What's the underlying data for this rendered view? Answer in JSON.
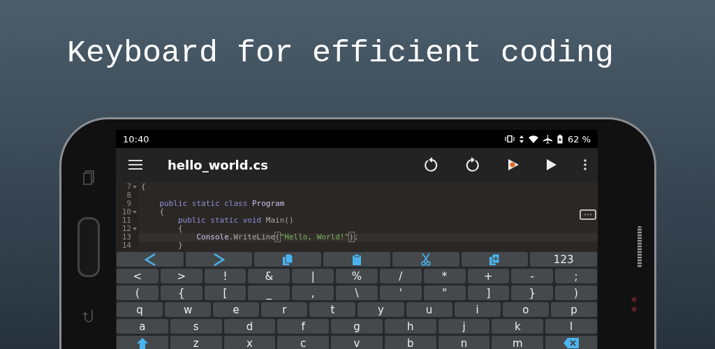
{
  "headline": "Keyboard for efficient coding",
  "status_bar": {
    "time": "10:40",
    "battery": "62 %"
  },
  "toolbar": {
    "title": "hello_world.cs"
  },
  "editor": {
    "lines": [
      {
        "number": "7",
        "fold": true,
        "current": false,
        "tokens": [
          {
            "text": "{",
            "kind": "plain"
          }
        ]
      },
      {
        "number": "8",
        "fold": false,
        "current": false
      },
      {
        "number": "9",
        "fold": false,
        "current": false,
        "tokens": [
          {
            "text": "    public static class ",
            "kind": "keyword"
          },
          {
            "text": "Program",
            "kind": "type"
          }
        ]
      },
      {
        "number": "10",
        "fold": true,
        "current": false,
        "tokens": [
          {
            "text": "    {",
            "kind": "plain"
          }
        ]
      },
      {
        "number": "11",
        "fold": false,
        "current": false,
        "tokens": [
          {
            "text": "        public static void ",
            "kind": "keyword"
          },
          {
            "text": "Main()",
            "kind": "plain"
          }
        ]
      },
      {
        "number": "12",
        "fold": true,
        "current": false,
        "tokens": [
          {
            "text": "        {",
            "kind": "plain"
          }
        ]
      },
      {
        "number": "13",
        "fold": false,
        "current": true,
        "tokens": [
          {
            "text": "            Console",
            "kind": "type"
          },
          {
            "text": ".WriteLine",
            "kind": "plain"
          },
          {
            "text": "(",
            "kind": "match"
          },
          {
            "text": "\"Hello, World!\"",
            "kind": "string"
          },
          {
            "text": ")",
            "kind": "match"
          },
          {
            "text": ";",
            "kind": "plain"
          }
        ]
      },
      {
        "number": "14",
        "fold": false,
        "current": false,
        "tokens": [
          {
            "text": "        }",
            "kind": "plain"
          }
        ]
      }
    ]
  },
  "keyboard": {
    "rows": [
      {
        "keys": [
          {
            "kind": "left"
          },
          {
            "kind": "right"
          },
          {
            "kind": "copy"
          },
          {
            "kind": "paste"
          },
          {
            "kind": "cut"
          },
          {
            "kind": "duplicate"
          },
          {
            "kind": "text",
            "label": "123"
          }
        ]
      },
      {
        "keys": [
          {
            "kind": "text",
            "label": "<"
          },
          {
            "kind": "text",
            "label": ">"
          },
          {
            "kind": "text",
            "label": "!"
          },
          {
            "kind": "text",
            "label": "&"
          },
          {
            "kind": "text",
            "label": "|"
          },
          {
            "kind": "text",
            "label": "%"
          },
          {
            "kind": "text",
            "label": "/"
          },
          {
            "kind": "text",
            "label": "*"
          },
          {
            "kind": "text",
            "label": "+"
          },
          {
            "kind": "text",
            "label": "-"
          },
          {
            "kind": "text",
            "label": ";"
          }
        ]
      },
      {
        "keys": [
          {
            "kind": "text",
            "label": "("
          },
          {
            "kind": "text",
            "label": "{"
          },
          {
            "kind": "text",
            "label": "["
          },
          {
            "kind": "text",
            "label": "_"
          },
          {
            "kind": "text",
            "label": ","
          },
          {
            "kind": "text",
            "label": "\\"
          },
          {
            "kind": "text",
            "label": "'"
          },
          {
            "kind": "text",
            "label": "\""
          },
          {
            "kind": "text",
            "label": "]"
          },
          {
            "kind": "text",
            "label": "}"
          },
          {
            "kind": "text",
            "label": ")"
          }
        ]
      },
      {
        "keys": [
          {
            "kind": "text",
            "label": "q"
          },
          {
            "kind": "text",
            "label": "w"
          },
          {
            "kind": "text",
            "label": "e"
          },
          {
            "kind": "text",
            "label": "r"
          },
          {
            "kind": "text",
            "label": "t"
          },
          {
            "kind": "text",
            "label": "y"
          },
          {
            "kind": "text",
            "label": "u"
          },
          {
            "kind": "text",
            "label": "i"
          },
          {
            "kind": "text",
            "label": "o"
          },
          {
            "kind": "text",
            "label": "p"
          }
        ]
      },
      {
        "keys": [
          {
            "kind": "text",
            "label": "a"
          },
          {
            "kind": "text",
            "label": "s"
          },
          {
            "kind": "text",
            "label": "d"
          },
          {
            "kind": "text",
            "label": "f"
          },
          {
            "kind": "text",
            "label": "g"
          },
          {
            "kind": "text",
            "label": "h"
          },
          {
            "kind": "text",
            "label": "j"
          },
          {
            "kind": "text",
            "label": "k"
          },
          {
            "kind": "text",
            "label": "l"
          }
        ]
      },
      {
        "keys": [
          {
            "kind": "shift"
          },
          {
            "kind": "text",
            "label": "z"
          },
          {
            "kind": "text",
            "label": "x"
          },
          {
            "kind": "text",
            "label": "c"
          },
          {
            "kind": "text",
            "label": "v"
          },
          {
            "kind": "text",
            "label": "b"
          },
          {
            "kind": "text",
            "label": "n"
          },
          {
            "kind": "text",
            "label": "m"
          },
          {
            "kind": "backspace"
          }
        ]
      }
    ]
  }
}
